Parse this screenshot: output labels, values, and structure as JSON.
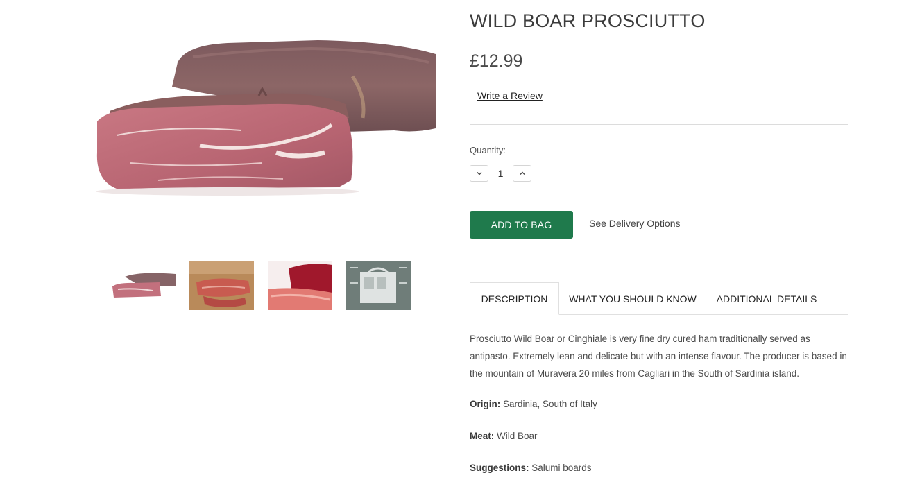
{
  "product": {
    "title": "WILD BOAR PROSCIUTTO",
    "price": "£12.99",
    "review_link": "Write a Review"
  },
  "quantity": {
    "label": "Quantity:",
    "value": "1"
  },
  "actions": {
    "add_to_bag": "ADD TO BAG",
    "delivery_link": "See Delivery Options"
  },
  "gallery": {
    "main_image": "wild-boar-prosciutto-block",
    "thumbnails": [
      {
        "image": "prosciutto-block-thumb"
      },
      {
        "image": "prosciutto-slices-board-thumb"
      },
      {
        "image": "prosciutto-sliced-red-thumb"
      },
      {
        "image": "delivery-packaging-info-thumb"
      }
    ]
  },
  "tabs": [
    {
      "label": "DESCRIPTION",
      "active": true
    },
    {
      "label": "WHAT YOU SHOULD KNOW",
      "active": false
    },
    {
      "label": "ADDITIONAL DETAILS",
      "active": false
    }
  ],
  "description": {
    "text": "Prosciutto Wild Boar or Cinghiale is very fine dry cured ham traditionally served as antipasto. Extremely lean and delicate but with an intense flavour. The producer is based in the mountain of Muravera 20 miles from Cagliari in the South of Sardinia island.",
    "origin_label": "Origin:",
    "origin_value": " Sardinia, South of Italy",
    "meat_label": "Meat:",
    "meat_value": " Wild Boar",
    "suggestions_label": "Suggestions:",
    "suggestions_value": " Salumi boards"
  },
  "colors": {
    "accent_green": "#1f7a4c",
    "text": "#444444",
    "divider": "#dcdcdc"
  }
}
